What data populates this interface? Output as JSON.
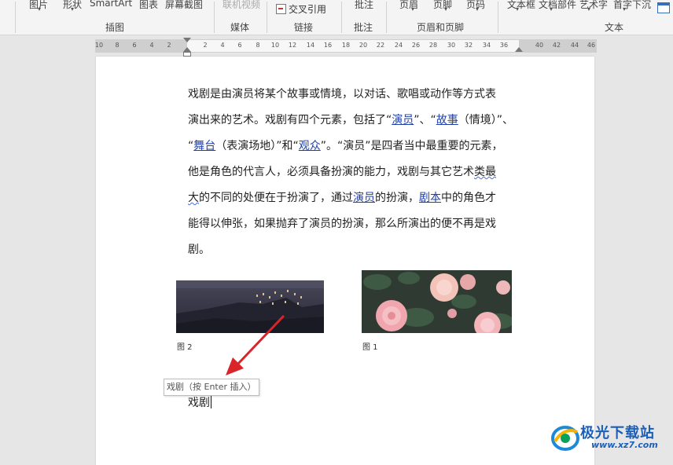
{
  "ribbon": {
    "cut_labels": [
      {
        "text": "图片",
        "faded": false
      },
      {
        "text": "形状",
        "faded": false
      },
      {
        "text": "SmartArt",
        "faded": false
      },
      {
        "text": "图表",
        "faded": false
      },
      {
        "text": "屏幕截图",
        "faded": false
      },
      {
        "text": "联机视频",
        "faded": true
      },
      {
        "text": "批注",
        "faded": false
      },
      {
        "text": "页眉",
        "faded": false
      },
      {
        "text": "页脚",
        "faded": false
      },
      {
        "text": "页码",
        "faded": false
      },
      {
        "text": "文本框",
        "faded": false
      },
      {
        "text": "文档部件",
        "faded": false
      },
      {
        "text": "艺术字",
        "faded": false
      },
      {
        "text": "首字下沉",
        "faded": false
      }
    ],
    "cross_reference_label": "交叉引用",
    "groups": [
      "插图",
      "媒体",
      "链接",
      "批注",
      "页眉和页脚",
      "文本"
    ]
  },
  "ruler": {
    "ticks": [
      "10",
      "8",
      "6",
      "4",
      "2",
      "2",
      "4",
      "6",
      "8",
      "10",
      "12",
      "14",
      "16",
      "18",
      "20",
      "22",
      "24",
      "26",
      "28",
      "30",
      "32",
      "34",
      "36",
      "40",
      "42",
      "44",
      "46"
    ]
  },
  "document": {
    "paragraph": {
      "l1": "戏剧是由演员将某个故事或情境，以对话、歌唱或动作等方式表",
      "l2_a": "演出来的艺术。戏剧有四个元素，包括了“",
      "link_actor": "演员",
      "l2_b": "”、“",
      "link_story": "故事",
      "l2_c": "（情境）”、",
      "l3_a": "“",
      "link_stage": "舞台",
      "l3_b": "（表演场地）”和“",
      "link_audience": "观众",
      "l3_c": "”。“演员”是四者当中最重要的元素，",
      "l4_a": "他是角色的代言人，必须具备扮演的能力，戏剧与其它艺术",
      "l4_squiggle": "类最",
      "l5_squiggle": "大",
      "l5_a": "的不同的处便在于扮演了，通过",
      "link_actor2": "演员",
      "l5_b": "的扮演，",
      "link_script": "剧本",
      "l5_c": "中的角色才",
      "l6": "能得以伸张，如果抛弃了演员的扮演，那么所演出的便不再是戏",
      "l7": "剧。"
    },
    "caption_left": "图 2",
    "caption_right": "图 1",
    "autocomplete_tip": "戏剧（按 Enter 插入）",
    "typed_text": "戏剧"
  },
  "watermark": {
    "name": "极光下载站",
    "url": "www.xz7.com"
  },
  "colors": {
    "link": "#1f3fa8",
    "arrow": "#d9242a",
    "watermark": "#1c5fb8"
  }
}
